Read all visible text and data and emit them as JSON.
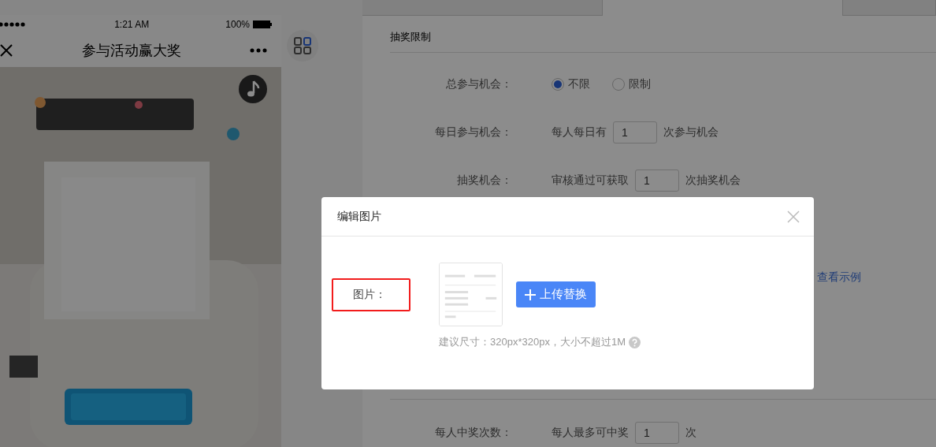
{
  "phone": {
    "status_bar": {
      "time": "1:21 AM",
      "battery": "100%"
    },
    "nav_bar": {
      "title": "参与活动赢大奖"
    }
  },
  "tabs": [
    {
      "selected": false
    },
    {
      "selected": true
    },
    {
      "selected": false
    }
  ],
  "section": {
    "title": "抽奖限制"
  },
  "form_rows": [
    {
      "kind": "radio",
      "label": "总参与机会：",
      "options": [
        {
          "label": "不限",
          "selected": true
        },
        {
          "label": "限制",
          "selected": false
        }
      ]
    },
    {
      "kind": "count",
      "label": "每日参与机会：",
      "prefix": "每人每日有",
      "value": "1",
      "suffix": "次参与机会"
    },
    {
      "kind": "count",
      "label": "抽奖机会：",
      "prefix": "审核通过可获取",
      "value": "1",
      "suffix": "次抽奖机会"
    }
  ],
  "example_link": "查看示例",
  "bottom_rows": [
    {
      "kind": "count",
      "label": "每人中奖次数：",
      "prefix": "每人最多可中奖",
      "value": "1",
      "suffix": "次"
    }
  ],
  "dialog": {
    "title": "编辑图片",
    "field_label": "图片：",
    "upload_button": "上传替换",
    "hint": "建议尺寸：320px*320px，大小不超过1M"
  }
}
